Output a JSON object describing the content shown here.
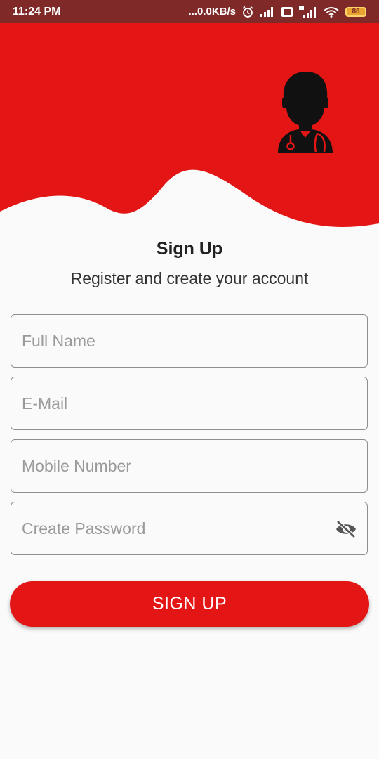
{
  "status_bar": {
    "time": "11:24 PM",
    "network_speed": "...0.0KB/s",
    "battery": "86",
    "icons": [
      "alarm-icon",
      "signal-icon",
      "volte-icon",
      "4g-signal-icon",
      "wifi-icon",
      "battery-icon"
    ]
  },
  "header": {
    "background_color": "#e31515",
    "illustration": "doctor-icon"
  },
  "form": {
    "title": "Sign Up",
    "subtitle": "Register and create your account",
    "full_name_placeholder": "Full Name",
    "email_placeholder": "E-Mail",
    "mobile_placeholder": "Mobile Number",
    "password_placeholder": "Create Password",
    "password_toggle_icon": "eye-off-icon",
    "submit_label": "SIGN UP"
  },
  "colors": {
    "accent": "#e31515",
    "status_bar": "#7f2a28",
    "background": "#fafafa"
  }
}
